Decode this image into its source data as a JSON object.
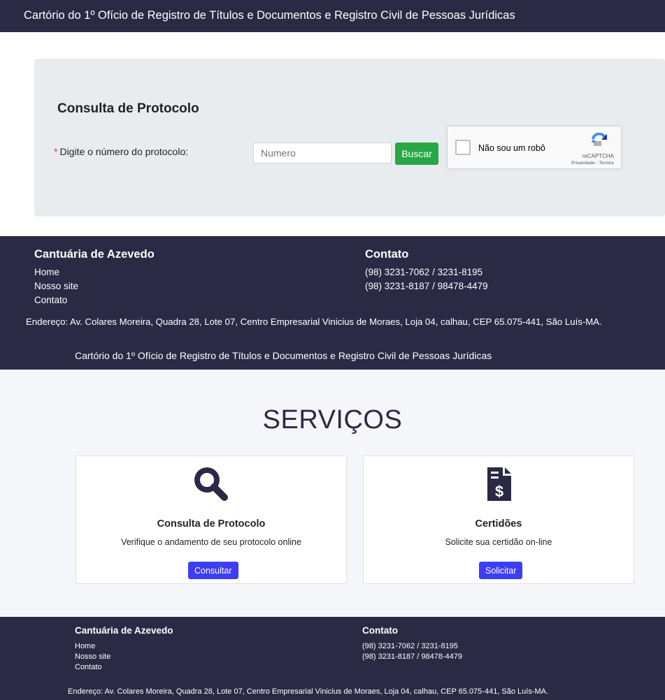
{
  "screen1": {
    "topbar_title": "Cartório do 1º Ofício de Registro de Títulos e Documentos e Registro Civil de Pessoas Jurídicas",
    "form": {
      "heading": "Consulta de Protocolo",
      "required_mark": "*",
      "label": "Digite o número do protocolo:",
      "input_value": "",
      "input_placeholder": "Numero",
      "search_button": "Buscar"
    },
    "recaptcha": {
      "checkbox_label": "Não sou um robô",
      "brand": "reCAPTCHA",
      "privacy_terms": "Privacidade - Termos"
    },
    "footer": {
      "name": "Cantuária de Azevedo",
      "links": [
        "Home",
        "Nosso site",
        "Contato"
      ],
      "contact_title": "Contato",
      "phones": [
        "(98) 3231-7062 / 3231-8195",
        "(98) 3231-8187 / 98478-4479"
      ],
      "address": "Endereço: Av. Colares Moreira, Quadra 28, Lote 07, Centro Empresarial Vinicius de Moraes, Loja 04, calhau, CEP 65.075-441, São Luís-MA."
    }
  },
  "screen2": {
    "topbar_title": "Cartório do 1º Ofício de Registro de Títulos e Documentos e Registro Civil de Pessoas Jurídicas",
    "section_title": "SERVIÇOS",
    "cards": [
      {
        "icon": "search-icon",
        "title": "Consulta de Protocolo",
        "description": "Verifique o andamento de seu protocolo online",
        "button": "Consultar"
      },
      {
        "icon": "invoice-dollar-icon",
        "title": "Certidões",
        "description": "Solicite sua certidão on-line",
        "button": "Solicitar"
      }
    ],
    "footer": {
      "name": "Cantuária de Azevedo",
      "links": [
        "Home",
        "Nosso site",
        "Contato"
      ],
      "contact_title": "Contato",
      "phones": [
        "(98) 3231-7062 / 3231-8195",
        "(98) 3231-8187 / 98478-4479"
      ],
      "address": "Endereço: Av. Colares Moreira, Quadra 28, Lote 07, Centro Empresarial Vinicius de Moraes, Loja 04, calhau, CEP 65.075-441, São Luís-MA."
    }
  },
  "colors": {
    "header_footer_bg": "#2b2a45",
    "panel_bg": "#e9ecef",
    "search_button_bg": "#28a745",
    "card_button_bg": "#3d3df5",
    "required_mark": "#dc3545",
    "services_bg": "#f5f6fa"
  }
}
